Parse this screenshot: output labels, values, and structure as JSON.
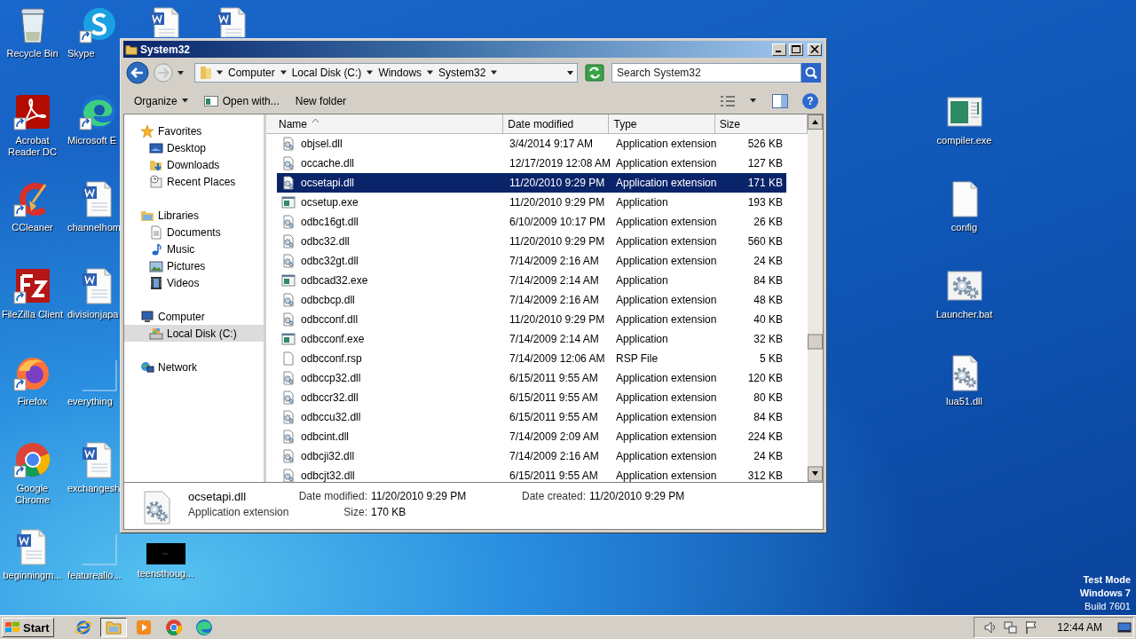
{
  "desktop": {
    "icons": [
      {
        "label": "Recycle Bin",
        "kind": "recycle",
        "shortcut": false
      },
      {
        "label": "Acrobat Reader DC",
        "kind": "pdf",
        "shortcut": true
      },
      {
        "label": "CCleaner",
        "kind": "cleaner",
        "shortcut": true
      },
      {
        "label": "FileZilla Client",
        "kind": "ftp",
        "shortcut": true
      },
      {
        "label": "Firefox",
        "kind": "firefox",
        "shortcut": true
      },
      {
        "label": "Google Chrome",
        "kind": "chrome",
        "shortcut": true
      },
      {
        "label": "beginningm...",
        "kind": "doc",
        "shortcut": false
      },
      {
        "label": "Skype",
        "kind": "chat",
        "shortcut": true
      },
      {
        "label": "Microsoft E",
        "kind": "edge",
        "shortcut": true
      },
      {
        "label": "channelhom",
        "kind": "doc",
        "shortcut": false
      },
      {
        "label": "divisionjapa",
        "kind": "doc",
        "shortcut": false
      },
      {
        "label": "everything",
        "kind": "blank",
        "shortcut": false
      },
      {
        "label": "exchangesh",
        "kind": "doc",
        "shortcut": false
      },
      {
        "label": "featureallo...",
        "kind": "blank",
        "shortcut": false
      },
      {
        "kind": "doc",
        "shortcut": false
      },
      {
        "label": "teensthoug...",
        "kind": "dark",
        "shortcut": false
      },
      {
        "kind": "doc",
        "shortcut": false
      },
      {
        "label": "compiler.exe",
        "kind": "program",
        "shortcut": false
      },
      {
        "label": "config",
        "kind": "file",
        "shortcut": false
      },
      {
        "label": "Launcher.bat",
        "kind": "gearwin",
        "shortcut": false
      },
      {
        "label": "lua51.dll",
        "kind": "gearfile",
        "shortcut": false
      }
    ],
    "watermark": [
      "Test Mode",
      "Windows 7",
      "Build 7601"
    ]
  },
  "window": {
    "title": "System32",
    "breadcrumb": [
      "Computer",
      "Local Disk (C:)",
      "Windows",
      "System32"
    ],
    "search": {
      "placeholder": "Search System32"
    },
    "toolbar": [
      {
        "label": "Organize",
        "kind": "menu"
      },
      {
        "label": "Open with...",
        "kind": "open"
      },
      {
        "label": "New folder",
        "kind": "plain"
      }
    ],
    "help": "?",
    "navigation": [
      {
        "label": "Favorites",
        "kind": "favorites",
        "selected": false,
        "children": [
          {
            "label": "Desktop",
            "kind": "desktop",
            "selected": false
          },
          {
            "label": "Downloads",
            "kind": "downloads",
            "selected": false
          },
          {
            "label": "Recent Places",
            "kind": "recent",
            "selected": false
          }
        ]
      },
      {
        "label": "Libraries",
        "kind": "libraries",
        "selected": false,
        "children": [
          {
            "label": "Documents",
            "kind": "documents",
            "selected": false
          },
          {
            "label": "Music",
            "kind": "music",
            "selected": false
          },
          {
            "label": "Pictures",
            "kind": "pictures",
            "selected": false
          },
          {
            "label": "Videos",
            "kind": "videos",
            "selected": false
          }
        ]
      },
      {
        "label": "Computer",
        "kind": "computer",
        "selected": false,
        "children": [
          {
            "label": "Local Disk (C:)",
            "kind": "drive",
            "selected": true
          }
        ]
      },
      {
        "label": "Network",
        "kind": "network",
        "selected": false
      }
    ],
    "columns": [
      {
        "label": "Name",
        "sorted": true
      },
      {
        "label": "Date modified",
        "sorted": false
      },
      {
        "label": "Type",
        "sorted": false
      },
      {
        "label": "Size",
        "sorted": false
      }
    ],
    "rows": [
      {
        "name": "objsel.dll",
        "date": "3/4/2014 9:17 AM",
        "type": "Application extension",
        "size": "526 KB",
        "kind": "dll",
        "selected": false
      },
      {
        "name": "occache.dll",
        "date": "12/17/2019 12:08 AM",
        "type": "Application extension",
        "size": "127 KB",
        "kind": "dll",
        "selected": false
      },
      {
        "name": "ocsetapi.dll",
        "date": "11/20/2010 9:29 PM",
        "type": "Application extension",
        "size": "171 KB",
        "kind": "dll",
        "selected": true
      },
      {
        "name": "ocsetup.exe",
        "date": "11/20/2010 9:29 PM",
        "type": "Application",
        "size": "193 KB",
        "kind": "exe",
        "selected": false
      },
      {
        "name": "odbc16gt.dll",
        "date": "6/10/2009 10:17 PM",
        "type": "Application extension",
        "size": "26 KB",
        "kind": "dll",
        "selected": false
      },
      {
        "name": "odbc32.dll",
        "date": "11/20/2010 9:29 PM",
        "type": "Application extension",
        "size": "560 KB",
        "kind": "dll",
        "selected": false
      },
      {
        "name": "odbc32gt.dll",
        "date": "7/14/2009 2:16 AM",
        "type": "Application extension",
        "size": "24 KB",
        "kind": "dll",
        "selected": false
      },
      {
        "name": "odbcad32.exe",
        "date": "7/14/2009 2:14 AM",
        "type": "Application",
        "size": "84 KB",
        "kind": "exe",
        "selected": false
      },
      {
        "name": "odbcbcp.dll",
        "date": "7/14/2009 2:16 AM",
        "type": "Application extension",
        "size": "48 KB",
        "kind": "dll",
        "selected": false
      },
      {
        "name": "odbcconf.dll",
        "date": "11/20/2010 9:29 PM",
        "type": "Application extension",
        "size": "40 KB",
        "kind": "dll",
        "selected": false
      },
      {
        "name": "odbcconf.exe",
        "date": "7/14/2009 2:14 AM",
        "type": "Application",
        "size": "32 KB",
        "kind": "exe",
        "selected": false
      },
      {
        "name": "odbcconf.rsp",
        "date": "7/14/2009 12:06 AM",
        "type": "RSP File",
        "size": "5 KB",
        "kind": "file",
        "selected": false
      },
      {
        "name": "odbccp32.dll",
        "date": "6/15/2011 9:55 AM",
        "type": "Application extension",
        "size": "120 KB",
        "kind": "dll",
        "selected": false
      },
      {
        "name": "odbccr32.dll",
        "date": "6/15/2011 9:55 AM",
        "type": "Application extension",
        "size": "80 KB",
        "kind": "dll",
        "selected": false
      },
      {
        "name": "odbccu32.dll",
        "date": "6/15/2011 9:55 AM",
        "type": "Application extension",
        "size": "84 KB",
        "kind": "dll",
        "selected": false
      },
      {
        "name": "odbcint.dll",
        "date": "7/14/2009 2:09 AM",
        "type": "Application extension",
        "size": "224 KB",
        "kind": "dll",
        "selected": false
      },
      {
        "name": "odbcji32.dll",
        "date": "7/14/2009 2:16 AM",
        "type": "Application extension",
        "size": "24 KB",
        "kind": "dll",
        "selected": false
      },
      {
        "name": "odbcjt32.dll",
        "date": "6/15/2011 9:55 AM",
        "type": "Application extension",
        "size": "312 KB",
        "kind": "dll",
        "selected": false
      }
    ],
    "details": {
      "name": "ocsetapi.dll",
      "type": "Application extension",
      "fields": [
        {
          "label": "Date modified:",
          "value": "11/20/2010 9:29 PM"
        },
        {
          "label": "Size:",
          "value": "170 KB"
        },
        {
          "label": "Date created:",
          "value": "11/20/2010 9:29 PM"
        }
      ]
    }
  },
  "taskbar": {
    "start": "Start",
    "apps": [
      {
        "kind": "ie",
        "active": false
      },
      {
        "kind": "explorer",
        "active": true
      },
      {
        "kind": "media",
        "active": false
      },
      {
        "kind": "chrome",
        "active": false
      },
      {
        "kind": "edge",
        "active": false
      }
    ],
    "clock": "12:44 AM"
  }
}
